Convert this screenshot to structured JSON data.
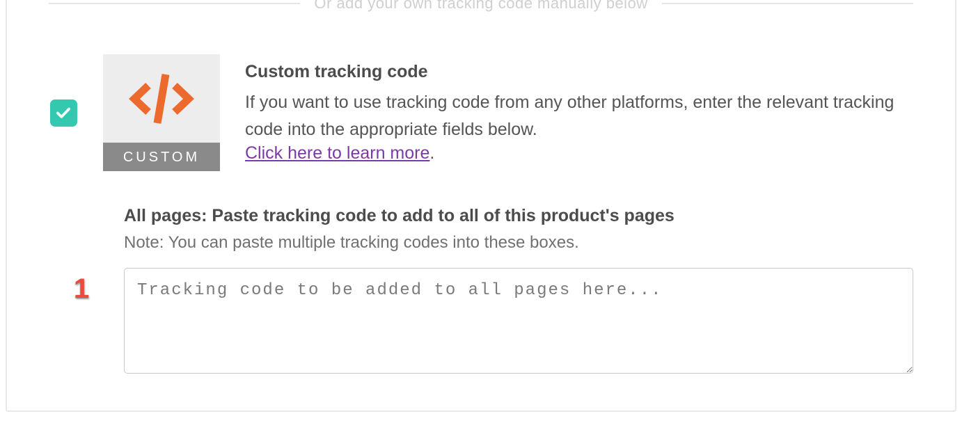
{
  "divider": {
    "text": "Or add your own tracking code manually below"
  },
  "custom_option": {
    "tile_label": "CUSTOM",
    "title": "Custom tracking code",
    "description": "If you want to use tracking code from any other platforms, enter the relevant tracking code into the appropriate fields below.",
    "learn_more_label": "Click here to learn more",
    "learn_more_trailer": "."
  },
  "all_pages": {
    "title": "All pages: Paste tracking code to add to all of this product's pages",
    "note": "Note: You can paste multiple tracking codes into these boxes.",
    "placeholder": "Tracking code to be added to all pages here...",
    "value": ""
  },
  "annotation": {
    "step1": "1"
  }
}
